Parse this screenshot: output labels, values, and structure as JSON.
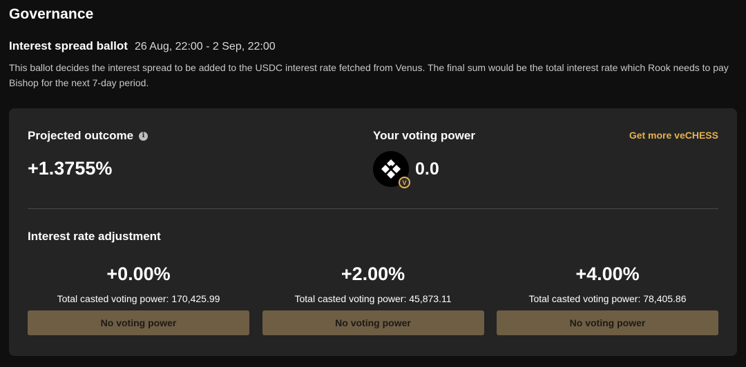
{
  "page": {
    "title": "Governance"
  },
  "ballot": {
    "title": "Interest spread ballot",
    "dates": "26 Aug, 22:00 - 2 Sep, 22:00",
    "description": "This ballot decides the interest spread to be added to the USDC interest rate fetched from Venus. The final sum would be the total interest rate which Rook needs to pay Bishop for the next 7-day period."
  },
  "projected": {
    "label": "Projected outcome",
    "value": "+1.3755%",
    "info_icon": "info-icon"
  },
  "voting_power": {
    "label": "Your voting power",
    "value": "0.0",
    "get_more_label": "Get more veCHESS",
    "token_icon": "chess-token-icon",
    "badge_letter": "V"
  },
  "adjustment": {
    "label": "Interest rate adjustment",
    "options": [
      {
        "value": "+0.00%",
        "total": "Total casted voting power: 170,425.99",
        "button_label": "No voting power"
      },
      {
        "value": "+2.00%",
        "total": "Total casted voting power: 45,873.11",
        "button_label": "No voting power"
      },
      {
        "value": "+4.00%",
        "total": "Total casted voting power: 78,405.86",
        "button_label": "No voting power"
      }
    ]
  },
  "colors": {
    "background": "#0f0f0f",
    "card": "#242424",
    "accent": "#e6b24c",
    "button": "#6e5e44"
  }
}
